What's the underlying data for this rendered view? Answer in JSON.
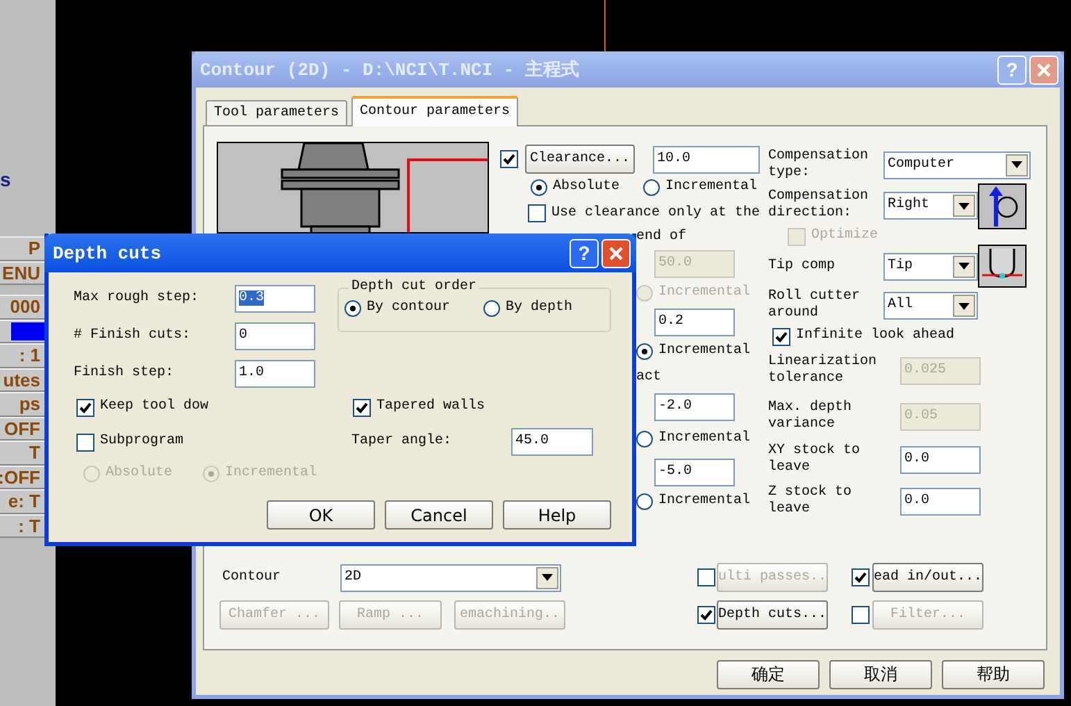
{
  "background_app": {
    "side_text": "s",
    "rows": [
      {
        "kind": "label",
        "text": "P"
      },
      {
        "kind": "label",
        "text": "ENU"
      },
      {
        "kind": "label",
        "text": "000"
      },
      {
        "kind": "bar"
      },
      {
        "kind": "label",
        "text": ": 1"
      },
      {
        "kind": "label",
        "text": "utes"
      },
      {
        "kind": "label",
        "text": "ps"
      },
      {
        "kind": "label",
        "text": "OFF"
      },
      {
        "kind": "label",
        "text": "T"
      },
      {
        "kind": "label",
        "text": ":OFF"
      },
      {
        "kind": "label",
        "text": "e: T"
      },
      {
        "kind": "label",
        "text": ": T"
      }
    ]
  },
  "contour_dialog": {
    "title": "Contour (2D) - D:\\NCI\\T.NCI - 主程式",
    "help": "?",
    "tabs": [
      {
        "label": "Tool parameters",
        "selected": false
      },
      {
        "label": "Contour parameters",
        "selected": true
      }
    ],
    "middle": [
      {
        "kind": "clearance",
        "checked": true,
        "button": "Clearance...",
        "value": "10.0"
      },
      {
        "kind": "radios",
        "disabled": false,
        "options": [
          {
            "label": "Absolute",
            "selected": true
          },
          {
            "label": "Incremental",
            "selected": false
          }
        ]
      },
      {
        "kind": "checkbox",
        "label": "Use clearance only at the",
        "checked": false
      },
      {
        "kind": "text",
        "text": "end of"
      },
      {
        "kind": "field",
        "value": "50.0",
        "disabled": true
      },
      {
        "kind": "radios",
        "disabled": true,
        "options": [
          {
            "label": "Incremental",
            "selected": false
          }
        ]
      },
      {
        "kind": "field",
        "value": "0.2",
        "disabled": false
      },
      {
        "kind": "radios",
        "disabled": false,
        "options": [
          {
            "label": "Incremental",
            "selected": true
          }
        ]
      },
      {
        "kind": "text",
        "text": "act"
      },
      {
        "kind": "field",
        "value": "-2.0",
        "disabled": false
      },
      {
        "kind": "radios",
        "disabled": false,
        "options": [
          {
            "label": "Incremental",
            "selected": false
          }
        ]
      },
      {
        "kind": "field",
        "value": "-5.0",
        "disabled": false
      },
      {
        "kind": "radios",
        "disabled": false,
        "options": [
          {
            "label": "Incremental",
            "selected": false
          }
        ]
      }
    ],
    "right": [
      {
        "kind": "select",
        "label": "Compensation type:",
        "value": "Computer"
      },
      {
        "kind": "select",
        "label": "Compensation direction:",
        "value": "Right"
      },
      {
        "kind": "checkbox",
        "label": "Optimize",
        "checked": false,
        "disabled": true
      },
      {
        "kind": "select",
        "label": "Tip comp",
        "value": "Tip"
      },
      {
        "kind": "select",
        "label": "Roll cutter around",
        "value": "All"
      },
      {
        "kind": "checkbox",
        "label": "Infinite look ahead",
        "checked": true,
        "disabled": false
      },
      {
        "kind": "field",
        "label": "Linearization tolerance",
        "value": "0.025",
        "disabled": true
      },
      {
        "kind": "field",
        "label": "Max. depth variance",
        "value": "0.05",
        "disabled": true
      },
      {
        "kind": "field",
        "label": "XY stock to leave",
        "value": "0.0",
        "disabled": false
      },
      {
        "kind": "field",
        "label": "Z stock to leave",
        "value": "0.0",
        "disabled": false
      }
    ],
    "contour_label": "Contour",
    "contour_value": "2D",
    "left_buttons": [
      {
        "label": "Chamfer ...",
        "disabled": true
      },
      {
        "label": "Ramp ...",
        "disabled": true
      },
      {
        "label": "emachining..",
        "disabled": true
      }
    ],
    "options": [
      {
        "label": "ulti passes..",
        "checked": false,
        "disabled": true
      },
      {
        "label": "ead in/out...",
        "checked": true,
        "disabled": false
      },
      {
        "label": "Depth cuts...",
        "checked": true,
        "disabled": false
      },
      {
        "label": "Filter...",
        "checked": false,
        "disabled": true
      }
    ],
    "buttons": [
      "确定",
      "取消",
      "帮助"
    ]
  },
  "depth_dialog": {
    "title": "Depth cuts",
    "help": "?",
    "fields": [
      {
        "label": "Max rough step:",
        "value": "0.3",
        "text_selected": true
      },
      {
        "label": "# Finish cuts:",
        "value": "0",
        "text_selected": false
      },
      {
        "label": "Finish step:",
        "value": "1.0",
        "text_selected": false
      }
    ],
    "order": {
      "legend": "Depth cut order",
      "options": [
        {
          "label": "By contour",
          "selected": true
        },
        {
          "label": "By depth",
          "selected": false
        }
      ]
    },
    "keep_tool_down": {
      "label": "Keep tool dow",
      "checked": true
    },
    "tapered_walls": {
      "label": "Tapered walls",
      "checked": true
    },
    "subprogram": {
      "label": "Subprogram",
      "checked": false
    },
    "taper_angle": {
      "label": "Taper angle:",
      "value": "45.0"
    },
    "sub_mode": {
      "disabled": true,
      "options": [
        {
          "label": "Absolute",
          "selected": false
        },
        {
          "label": "Incremental",
          "selected": true
        }
      ]
    },
    "buttons": [
      "OK",
      "Cancel",
      "Help"
    ]
  }
}
